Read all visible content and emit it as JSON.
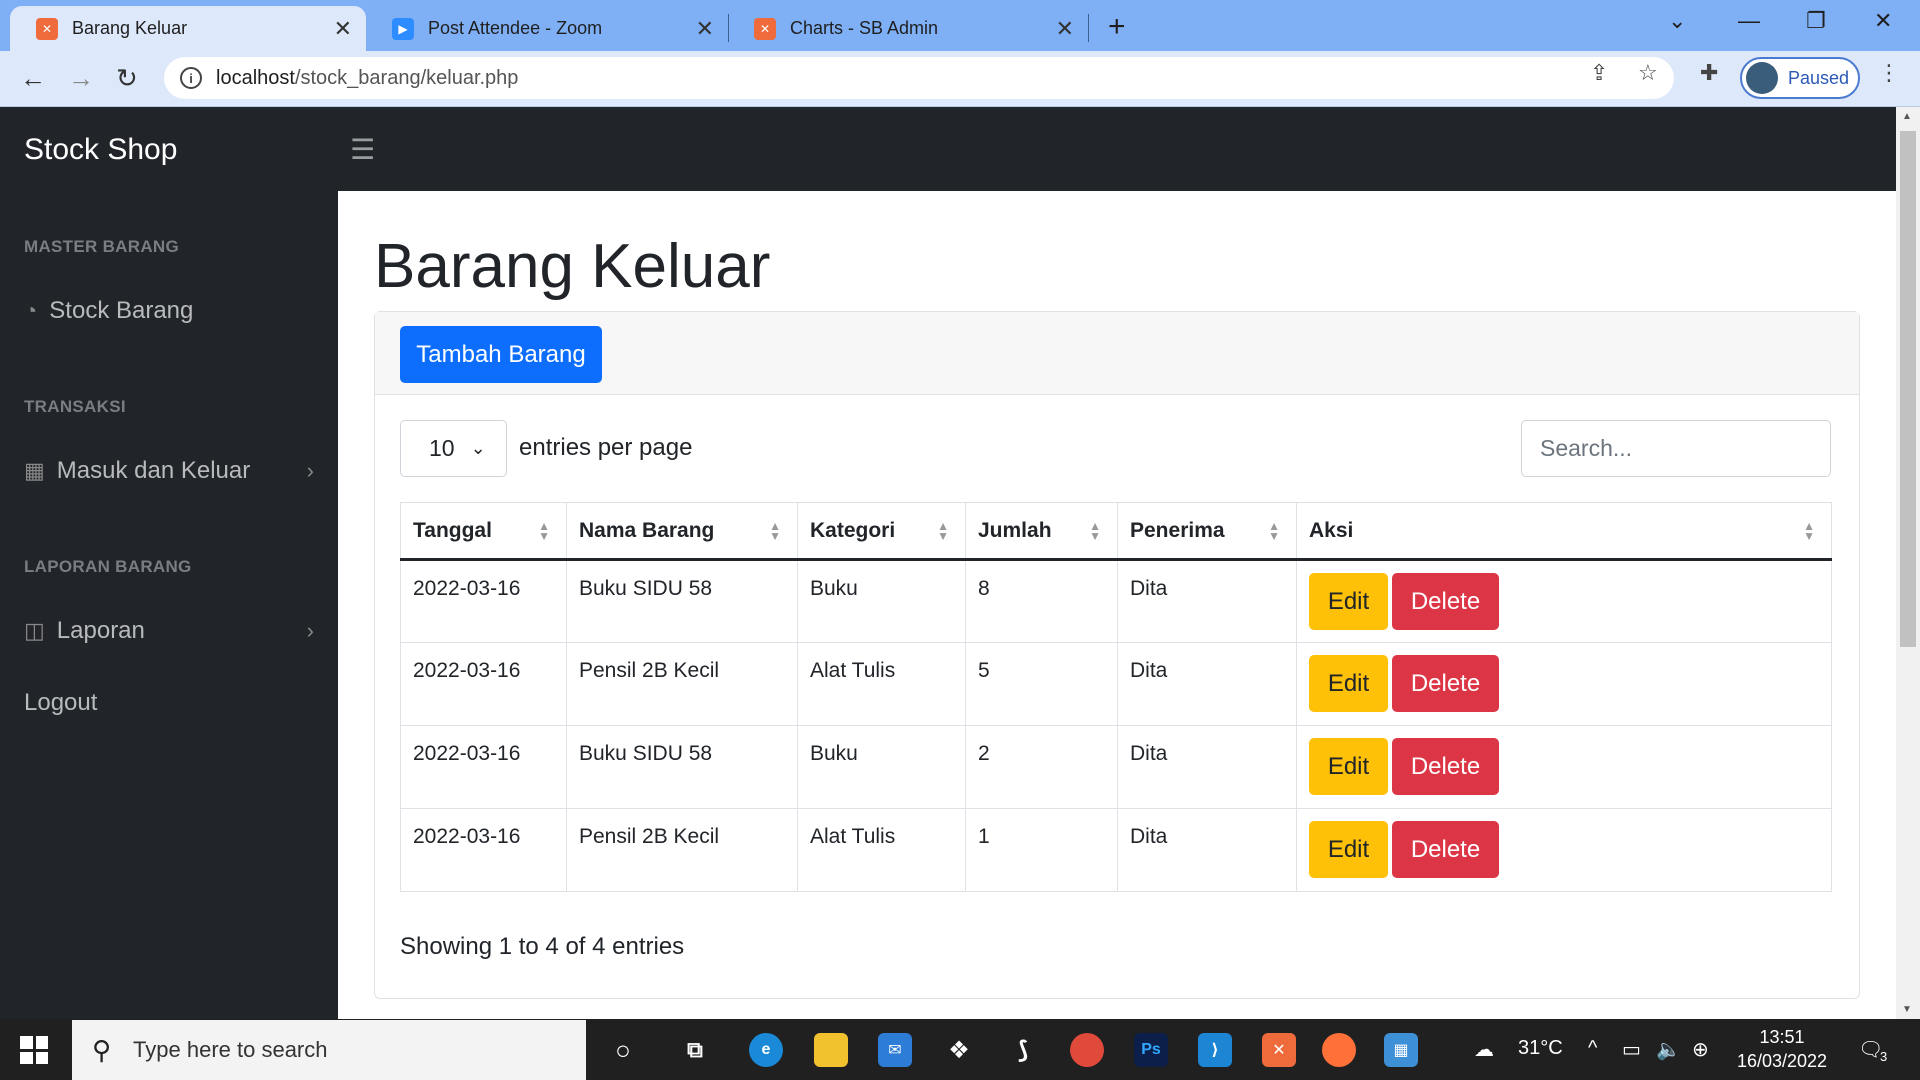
{
  "browser": {
    "tabs": [
      {
        "title": "Barang Keluar",
        "icon": "xampp-icon",
        "active": true
      },
      {
        "title": "Post Attendee - Zoom",
        "icon": "zoom-icon",
        "active": false
      },
      {
        "title": "Charts - SB Admin",
        "icon": "xampp-icon",
        "active": false
      }
    ],
    "url_host": "localhost",
    "url_path": "/stock_barang/keluar.php",
    "profile_label": "Paused"
  },
  "sidebar": {
    "brand": "Stock Shop",
    "sections": [
      {
        "heading": "MASTER BARANG",
        "items": [
          {
            "label": "Stock Barang",
            "icon": "dashboard-icon"
          }
        ]
      },
      {
        "heading": "TRANSAKSI",
        "items": [
          {
            "label": "Masuk dan Keluar",
            "icon": "table-icon"
          }
        ]
      },
      {
        "heading": "LAPORAN BARANG",
        "items": [
          {
            "label": "Laporan",
            "icon": "columns-icon"
          }
        ]
      }
    ],
    "logout": "Logout"
  },
  "main": {
    "title": "Barang Keluar",
    "add_button": "Tambah Barang",
    "entries_value": "10",
    "entries_label": "entries per page",
    "search_placeholder": "Search...",
    "table": {
      "headers": [
        "Tanggal",
        "Nama Barang",
        "Kategori",
        "Jumlah",
        "Penerima",
        "Aksi"
      ],
      "rows": [
        [
          "2022-03-16",
          "Buku SIDU 58",
          "Buku",
          "8",
          "Dita"
        ],
        [
          "2022-03-16",
          "Pensil 2B Kecil",
          "Alat Tulis",
          "5",
          "Dita"
        ],
        [
          "2022-03-16",
          "Buku SIDU 58",
          "Buku",
          "2",
          "Dita"
        ],
        [
          "2022-03-16",
          "Pensil 2B Kecil",
          "Alat Tulis",
          "1",
          "Dita"
        ]
      ],
      "edit_label": "Edit",
      "delete_label": "Delete"
    },
    "showing": "Showing 1 to 4 of 4 entries"
  },
  "taskbar": {
    "search_placeholder": "Type here to search",
    "temperature": "31°C",
    "time": "13:51",
    "date": "16/03/2022",
    "notification_count": "3"
  },
  "colors": {
    "primary": "#0d6efd",
    "warning": "#ffc107",
    "danger": "#dc3545",
    "sidebar_bg": "#212529"
  }
}
